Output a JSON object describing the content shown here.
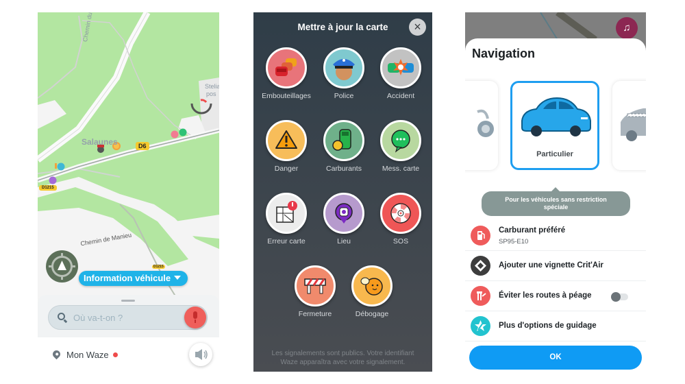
{
  "map_screen": {
    "labels": {
      "chemin_du": "Chemin du",
      "salaunes": "Salaunes",
      "chemin_de_manieu": "Chemin de Manieu",
      "stelia": "Stelia",
      "stelia_sub": "pos"
    },
    "road_badges": {
      "d6": "D6",
      "d1215_a": "D1215",
      "d1215_b": "D1215"
    },
    "info_pill": "Information véhicule",
    "search": {
      "placeholder": "Où va-t-on ?",
      "icon": "search-icon",
      "mic_icon": "microphone-icon",
      "mic_color": "#ef5f5b"
    },
    "bottom": {
      "mon_waze": "Mon Waze",
      "status_dot_color": "#ef4b4b",
      "sound_icon": "speaker-icon",
      "pin_icon": "location-pin-icon"
    },
    "colors": {
      "map_green": "#b3e6a1",
      "pill": "#1fb3e8"
    }
  },
  "report_screen": {
    "title": "Mettre à jour la carte",
    "close_icon": "close-icon",
    "items": [
      {
        "label": "Embouteillages",
        "icon": "traffic-jam-icon",
        "bg": "#e8747a"
      },
      {
        "label": "Police",
        "icon": "police-icon",
        "bg": "#7fc9cf"
      },
      {
        "label": "Accident",
        "icon": "accident-icon",
        "bg": "#c2c2c2"
      },
      {
        "label": "Danger",
        "icon": "hazard-icon",
        "bg": "#f7bd5a"
      },
      {
        "label": "Carburants",
        "icon": "fuel-icon",
        "bg": "#6fb08a"
      },
      {
        "label": "Mess. carte",
        "icon": "map-chat-icon",
        "bg": "#b8d8a0"
      },
      {
        "label": "Erreur carte",
        "icon": "map-error-icon",
        "bg": "#ececec"
      },
      {
        "label": "Lieu",
        "icon": "place-icon",
        "bg": "#b69acd"
      },
      {
        "label": "SOS",
        "icon": "sos-icon",
        "bg": "#ef5656"
      },
      {
        "label": "Fermeture",
        "icon": "road-closure-icon",
        "bg": "#f08a6c"
      },
      {
        "label": "Débogage",
        "icon": "debug-icon",
        "bg": "#f8b84e"
      }
    ],
    "footer_line1": "Les signalements sont publics. Votre identifiant",
    "footer_line2": "Waze apparaîtra avec votre signalement."
  },
  "navigation_screen": {
    "title": "Navigation",
    "music_icon": "music-note-icon",
    "vehicles": [
      {
        "name": "",
        "icon": "motorcycle-icon",
        "selected": false
      },
      {
        "name": "Particulier",
        "icon": "car-icon",
        "selected": true
      },
      {
        "name": "",
        "icon": "taxi-icon",
        "selected": false
      }
    ],
    "tooltip_line1": "Pour les véhicules sans restriction",
    "tooltip_line2": "spéciale",
    "options": [
      {
        "title": "Carburant préféré",
        "subtitle": "SP95-E10",
        "icon": "fuel-pump-icon",
        "color": "#ef5b5b"
      },
      {
        "title": "Ajouter une vignette Crit'Air",
        "icon": "critair-icon",
        "color": "#3d3d3d"
      },
      {
        "title": "Éviter les routes à péage",
        "icon": "toll-icon",
        "color": "#ef5b5b",
        "toggle": false
      },
      {
        "title": "Plus d'options de guidage",
        "icon": "guidance-icon",
        "color": "#22c3cf"
      }
    ],
    "ok_label": "OK",
    "accent": "#0f9bf4"
  }
}
